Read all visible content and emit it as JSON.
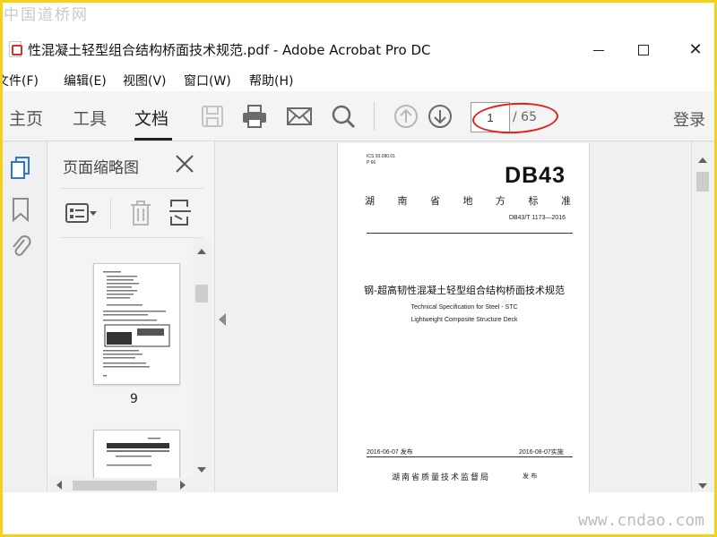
{
  "watermarks": {
    "top": "中国道桥网",
    "bottom": "www.cndao.com"
  },
  "window": {
    "title": "性混凝土轻型组合结构桥面技术规范.pdf - Adobe Acrobat Pro DC",
    "minimize_icon": "minimize-icon",
    "maximize_icon": "maximize-icon",
    "close_glyph": "✕"
  },
  "menu": [
    "文件(F)",
    "编辑(E)",
    "视图(V)",
    "窗口(W)",
    "帮助(H)"
  ],
  "toolbar": {
    "tabs": [
      "主页",
      "工具",
      "文档"
    ],
    "active_tab": "文档",
    "icons": [
      "save-icon",
      "print-icon",
      "email-icon",
      "search-icon",
      "page-up-icon",
      "page-down-icon"
    ],
    "page_current": "1",
    "page_total": "/ 65",
    "login": "登录"
  },
  "left_strip": {
    "icons": [
      "page-thumbnails-icon",
      "bookmark-icon",
      "attachment-icon"
    ]
  },
  "thumbnails": {
    "title": "页面缩略图",
    "close_glyph": "✕",
    "tool_icons": [
      "thumbnail-options-icon",
      "delete-icon",
      "extract-icon"
    ],
    "pages": [
      {
        "label": "9"
      },
      {
        "label": ""
      }
    ]
  },
  "document": {
    "ics": "ICS 93.080.01",
    "p_code": "P 66",
    "code": "DB43",
    "province_chars": [
      "湖",
      "南",
      "省",
      "地",
      "方",
      "标",
      "准"
    ],
    "std_no": "DB43/T 1173—2016",
    "cn_title": "钢-超高韧性混凝土轻型组合结构桥面技术规范",
    "en_title_line1": "Technical Specification for Steel - STC",
    "en_title_line2": "Lightweight Composite Structure Deck",
    "publish_date": "2016-06-07 发布",
    "implement_date": "2016-08-07实施",
    "issuer": "湖南省质量技术监督局",
    "issuer_suffix": "发 布"
  },
  "colors": {
    "highlight_ellipse": "#e0201b",
    "frame": "#f2d21b",
    "pdf_icon": "#d32f2f"
  }
}
